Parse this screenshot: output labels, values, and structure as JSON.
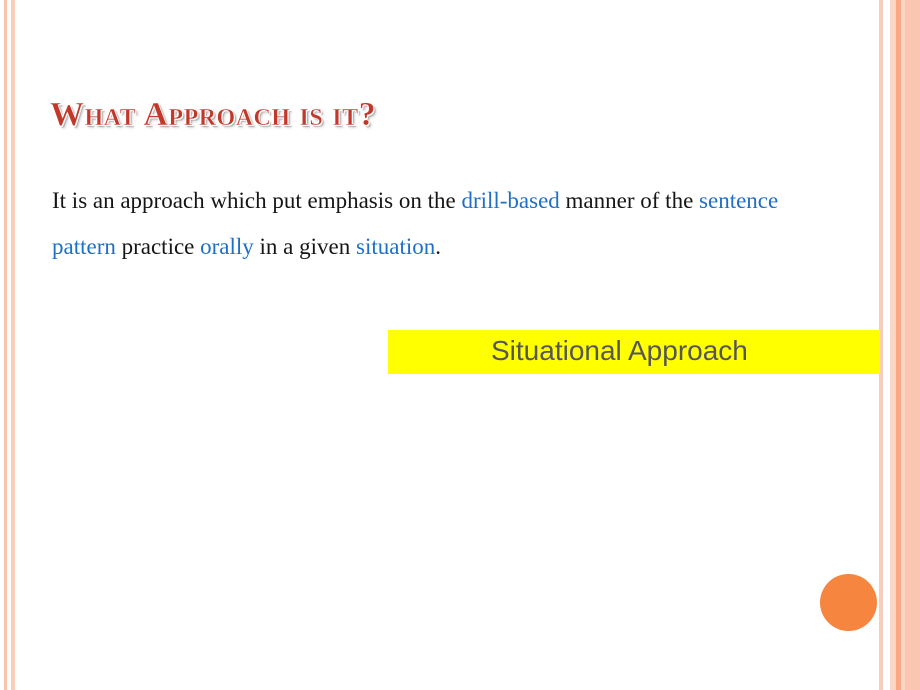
{
  "slide": {
    "title": "What Approach is it?",
    "body": {
      "segment_1": " It is an approach which put emphasis on the ",
      "highlight_1": "drill-based",
      "segment_2": " manner of the ",
      "highlight_2": "sentence pattern",
      "segment_3": " practice ",
      "highlight_3": "orally",
      "segment_4": " in a given ",
      "highlight_4": "situation",
      "segment_5": "."
    },
    "answer_box": {
      "label": "Situational Approach",
      "background_color": "#FFFF00",
      "text_color": "#565656"
    },
    "colors": {
      "title_color": "#C0392B",
      "highlight_blue": "#1F6FC4",
      "body_black": "#161616",
      "accent_orange": "#F5853F",
      "border_peach": "#FAC6B2",
      "border_peach_dark": "#F6A982"
    }
  }
}
